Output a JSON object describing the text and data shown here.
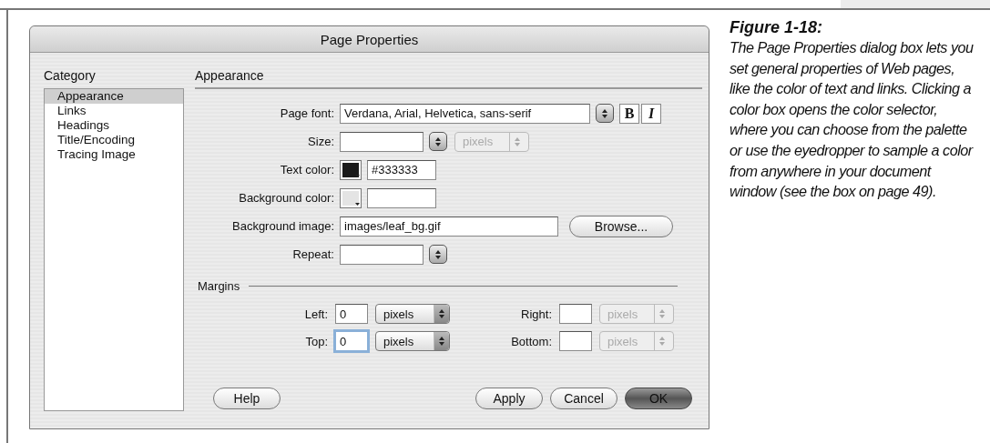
{
  "dialog": {
    "title": "Page Properties",
    "category_label": "Category",
    "categories": [
      {
        "label": "Appearance",
        "selected": true
      },
      {
        "label": "Links",
        "selected": false
      },
      {
        "label": "Headings",
        "selected": false
      },
      {
        "label": "Title/Encoding",
        "selected": false
      },
      {
        "label": "Tracing Image",
        "selected": false
      }
    ],
    "section_title": "Appearance",
    "page_font": {
      "label": "Page font:",
      "value": "Verdana, Arial, Helvetica, sans-serif",
      "bold_button": "B",
      "italic_button": "I"
    },
    "size": {
      "label": "Size:",
      "unit": "pixels",
      "unit_disabled": true
    },
    "text_color": {
      "label": "Text color:",
      "color": "#1a1a1a",
      "value": "#333333"
    },
    "background_color": {
      "label": "Background color:",
      "color": "#e4e4e4"
    },
    "background_image": {
      "label": "Background image:",
      "value": "images/leaf_bg.gif",
      "button": "Browse..."
    },
    "repeat": {
      "label": "Repeat:"
    },
    "margins_title": "Margins",
    "margins": [
      {
        "label": "Left:",
        "value": "0",
        "unit": "pixels",
        "disabled": false,
        "focused": false
      },
      {
        "label": "Right:",
        "unit": "pixels",
        "disabled": true,
        "focused": false
      },
      {
        "label": "Top:",
        "value": "0",
        "unit": "pixels",
        "disabled": false,
        "focused": true
      },
      {
        "label": "Bottom:",
        "unit": "pixels",
        "disabled": true,
        "focused": false
      }
    ],
    "buttons": [
      {
        "label": "Help",
        "kind": "help"
      },
      {
        "label": "Apply",
        "kind": "normal"
      },
      {
        "label": "Cancel",
        "kind": "normal"
      },
      {
        "label": "OK",
        "kind": "default"
      }
    ]
  },
  "caption": {
    "title": "Figure 1-18:",
    "text": "The Page Properties dialog box lets you set general properties of Web pages, like the color of text and links. Clicking a color box opens the color selector, where you can choose from the palette or use the eyedropper to sample a color from anywhere in your document window (see the box on page 49)."
  }
}
